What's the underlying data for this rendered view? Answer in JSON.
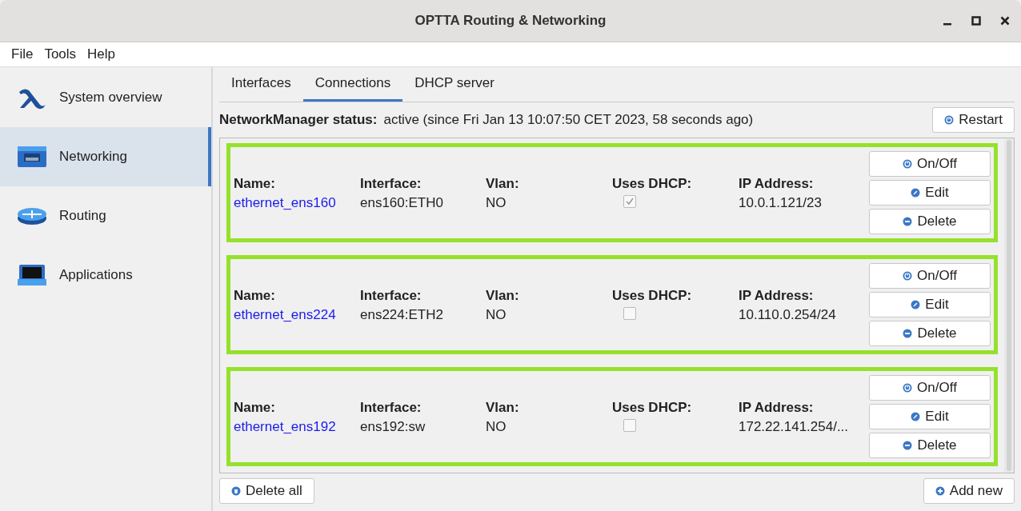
{
  "window": {
    "title": "OPTTA Routing & Networking"
  },
  "menu": [
    "File",
    "Tools",
    "Help"
  ],
  "sidebar": {
    "items": [
      {
        "label": "System overview",
        "selected": false
      },
      {
        "label": "Networking",
        "selected": true
      },
      {
        "label": "Routing",
        "selected": false
      },
      {
        "label": "Applications",
        "selected": false
      }
    ]
  },
  "tabs": [
    {
      "label": "Interfaces",
      "selected": false
    },
    {
      "label": "Connections",
      "selected": true
    },
    {
      "label": "DHCP server",
      "selected": false
    }
  ],
  "status": {
    "label": "NetworkManager status:",
    "value": "active (since Fri Jan 13 10:07:50 CET 2023, 58 seconds ago)",
    "button": "Restart"
  },
  "connections": [
    {
      "labels": [
        "Name:",
        "Interface:",
        "Vlan:",
        "Uses DHCP:",
        "IP Address:"
      ],
      "name": "ethernet_ens160",
      "interface": "ens160:ETH0",
      "vlan": "NO",
      "uses_dhcp": true,
      "ip": "10.0.1.121/23",
      "buttons": [
        "On/Off",
        "Edit",
        "Delete"
      ]
    },
    {
      "labels": [
        "Name:",
        "Interface:",
        "Vlan:",
        "Uses DHCP:",
        "IP Address:"
      ],
      "name": "ethernet_ens224",
      "interface": "ens224:ETH2",
      "vlan": "NO",
      "uses_dhcp": false,
      "ip": "10.110.0.254/24",
      "buttons": [
        "On/Off",
        "Edit",
        "Delete"
      ]
    },
    {
      "labels": [
        "Name:",
        "Interface:",
        "Vlan:",
        "Uses DHCP:",
        "IP Address:"
      ],
      "name": "ethernet_ens192",
      "interface": "ens192:sw",
      "vlan": "NO",
      "uses_dhcp": false,
      "ip": "172.22.141.254/...",
      "buttons": [
        "On/Off",
        "Edit",
        "Delete"
      ]
    }
  ],
  "footer": {
    "delete_all": "Delete all",
    "add_new": "Add new"
  }
}
